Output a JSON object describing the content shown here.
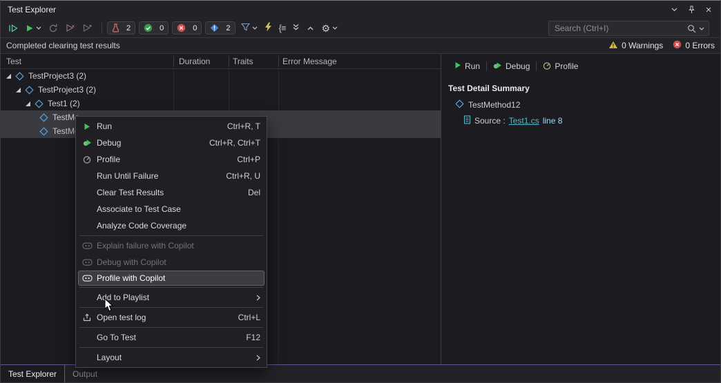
{
  "titlebar": {
    "title": "Test Explorer",
    "close_glyph": "×"
  },
  "toolbar": {
    "badges": [
      {
        "name": "total-tests",
        "count": "2"
      },
      {
        "name": "passed-tests",
        "count": "0"
      },
      {
        "name": "failed-tests",
        "count": "0"
      },
      {
        "name": "not-run-tests",
        "count": "2"
      }
    ],
    "group_by_glyph": "{≡",
    "gear_glyph": "⚙",
    "search": {
      "placeholder": "Search (Ctrl+I)"
    }
  },
  "infobar": {
    "message": "Completed clearing test results",
    "warnings": "0 Warnings",
    "errors": "0 Errors"
  },
  "test_table": {
    "columns": [
      "Test",
      "Duration",
      "Traits",
      "Error Message"
    ],
    "rows": [
      {
        "label": "TestProject3 (2)"
      },
      {
        "label": "TestProject3 (2)"
      },
      {
        "label": "Test1 (2)"
      },
      {
        "label": "TestMe"
      },
      {
        "label": "TestMe"
      }
    ]
  },
  "context_menu": {
    "items": [
      {
        "label": "Run",
        "shortcut": "Ctrl+R, T"
      },
      {
        "label": "Debug",
        "shortcut": "Ctrl+R, Ctrl+T"
      },
      {
        "label": "Profile",
        "shortcut": "Ctrl+P"
      },
      {
        "label": "Run Until Failure",
        "shortcut": "Ctrl+R, U"
      },
      {
        "label": "Clear Test Results",
        "shortcut": "Del"
      },
      {
        "label": "Associate to Test Case"
      },
      {
        "label": "Analyze Code Coverage"
      },
      {
        "label": "Explain failure with Copilot"
      },
      {
        "label": "Debug with Copilot"
      },
      {
        "label": "Profile with Copilot"
      },
      {
        "label": "Add to Playlist"
      },
      {
        "label": "Open test log",
        "shortcut": "Ctrl+L"
      },
      {
        "label": "Go To Test",
        "shortcut": "F12"
      },
      {
        "label": "Layout"
      }
    ]
  },
  "detail_pane": {
    "run_label": "Run",
    "debug_label": "Debug",
    "profile_label": "Profile",
    "summary_title": "Test Detail Summary",
    "test_name": "TestMethod12",
    "source_label": "Source :",
    "source_file": "Test1.cs",
    "source_line": "line 8"
  },
  "tabs": [
    {
      "label": "Test Explorer"
    },
    {
      "label": "Output"
    }
  ],
  "colors": {
    "run_green": "#41c25b",
    "link_teal": "#58b7c7",
    "warning_yellow": "#ddb63c",
    "error_red": "#d64a4a",
    "not_run_blue": "#3c86dd",
    "accent_line": "#5c5c96"
  }
}
